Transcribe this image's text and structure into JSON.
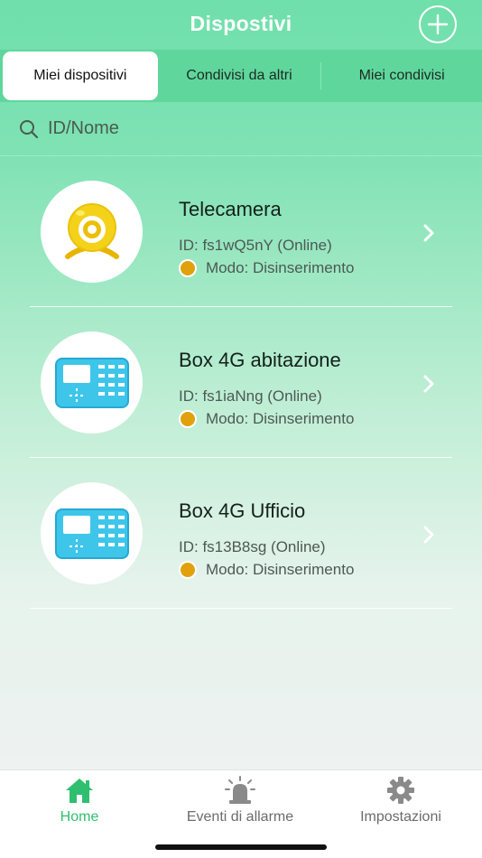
{
  "header": {
    "title": "Dispostivi"
  },
  "tabs": [
    {
      "label": "Miei dispositivi",
      "active": true
    },
    {
      "label": "Condivisi da altri",
      "active": false
    },
    {
      "label": "Miei condivisi",
      "active": false
    }
  ],
  "search": {
    "placeholder": "ID/Nome"
  },
  "devices": [
    {
      "name": "Telecamera",
      "id": "ID: fs1wQ5nY (Online)",
      "mode": "Modo: Disinserimento",
      "icon": "webcam-icon"
    },
    {
      "name": "Box 4G abitazione",
      "id": "ID: fs1iaNng (Online)",
      "mode": "Modo: Disinserimento",
      "icon": "alarm-panel-icon"
    },
    {
      "name": "Box 4G Ufficio",
      "id": "ID: fs13B8sg (Online)",
      "mode": "Modo: Disinserimento",
      "icon": "alarm-panel-icon"
    }
  ],
  "bottom_nav": [
    {
      "label": "Home",
      "icon": "home-icon",
      "active": true
    },
    {
      "label": "Eventi di allarme",
      "icon": "siren-icon",
      "active": false
    },
    {
      "label": "Impostazioni",
      "icon": "gear-icon",
      "active": false
    }
  ],
  "colors": {
    "accent": "#5fd79c",
    "mode_dot": "#e0a10c",
    "active_nav": "#2fbf6f",
    "panel_blue": "#3ec6ea"
  }
}
